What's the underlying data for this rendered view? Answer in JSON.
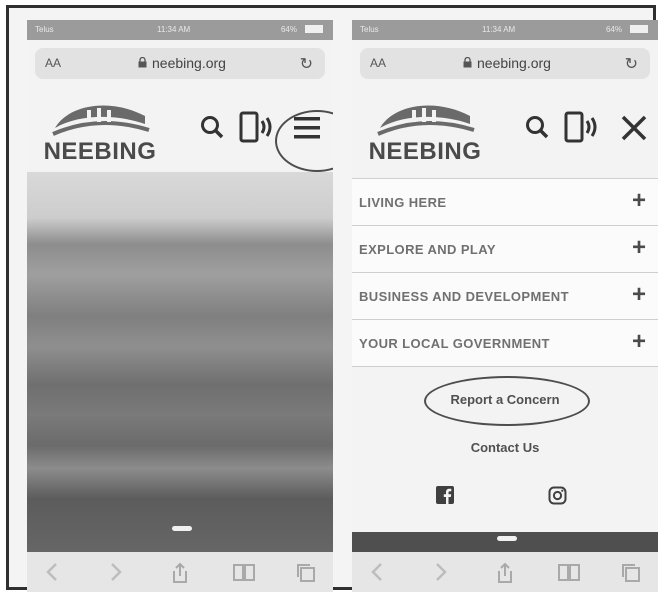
{
  "screens": [
    {
      "id": "left",
      "status": {
        "carrier": "Telus",
        "time": "11:34 AM",
        "battery": "64%"
      },
      "browser": {
        "aa": "AA",
        "url": "neebing.org"
      },
      "site": {
        "logo_text": "NEEBING"
      },
      "icons": [
        "search-icon",
        "phone-icon",
        "hamburger-menu-icon"
      ]
    },
    {
      "id": "right",
      "status": {
        "carrier": "Telus",
        "time": "11:34 AM",
        "battery": "64%"
      },
      "browser": {
        "aa": "AA",
        "url": "neebing.org"
      },
      "site": {
        "logo_text": "NEEBING"
      },
      "icons": [
        "search-icon",
        "phone-icon",
        "close-icon"
      ],
      "menu": [
        {
          "label": "LIVING HERE"
        },
        {
          "label": "EXPLORE AND PLAY"
        },
        {
          "label": "BUSINESS AND DEVELOPMENT"
        },
        {
          "label": "YOUR LOCAL GOVERNMENT"
        }
      ],
      "links": {
        "report": "Report a Concern",
        "contact": "Contact Us"
      },
      "social": [
        "facebook-icon",
        "instagram-icon"
      ]
    }
  ]
}
